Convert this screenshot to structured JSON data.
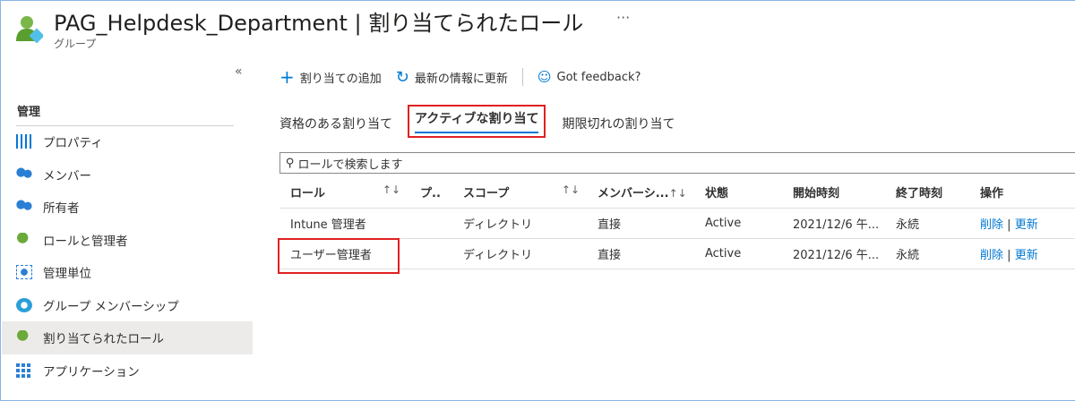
{
  "header": {
    "title": "PAG_Helpdesk_Department | 割り当てられたロール",
    "subtitle": "グループ",
    "more": "···",
    "collapse": "«"
  },
  "sidebar": {
    "section": "管理",
    "items": [
      {
        "label": "プロパティ",
        "icon": "properties-icon"
      },
      {
        "label": "メンバー",
        "icon": "members-icon"
      },
      {
        "label": "所有者",
        "icon": "owners-icon"
      },
      {
        "label": "ロールと管理者",
        "icon": "roles-icon"
      },
      {
        "label": "管理単位",
        "icon": "admin-units-icon"
      },
      {
        "label": "グループ メンバーシップ",
        "icon": "group-membership-icon"
      },
      {
        "label": "割り当てられたロール",
        "icon": "assigned-roles-icon"
      },
      {
        "label": "アプリケーション",
        "icon": "applications-icon"
      }
    ]
  },
  "toolbar": {
    "add": "割り当ての追加",
    "refresh": "最新の情報に更新",
    "feedback": "Got feedback?"
  },
  "tabs": [
    "資格のある割り当て",
    "アクティブな割り当て",
    "期限切れの割り当て"
  ],
  "search": {
    "placeholder": "ロールで検索します"
  },
  "table": {
    "headers": [
      "ロール",
      "プ..",
      "スコープ",
      "メンバーシ...",
      "状態",
      "開始時刻",
      "終了時刻",
      "操作"
    ],
    "sort": "↑↓",
    "rows": [
      [
        "Intune 管理者",
        "",
        "ディレクトリ",
        "直接",
        "Active",
        "2021/12/6 午...",
        "永続"
      ],
      [
        "ユーザー管理者",
        "",
        "ディレクトリ",
        "直接",
        "Active",
        "2021/12/6 午...",
        "永続"
      ]
    ],
    "actions": {
      "remove": "削除",
      "sep": "|",
      "update": "更新"
    }
  },
  "colors": {
    "accent": "#0078d4",
    "highlight": "#e02020"
  }
}
